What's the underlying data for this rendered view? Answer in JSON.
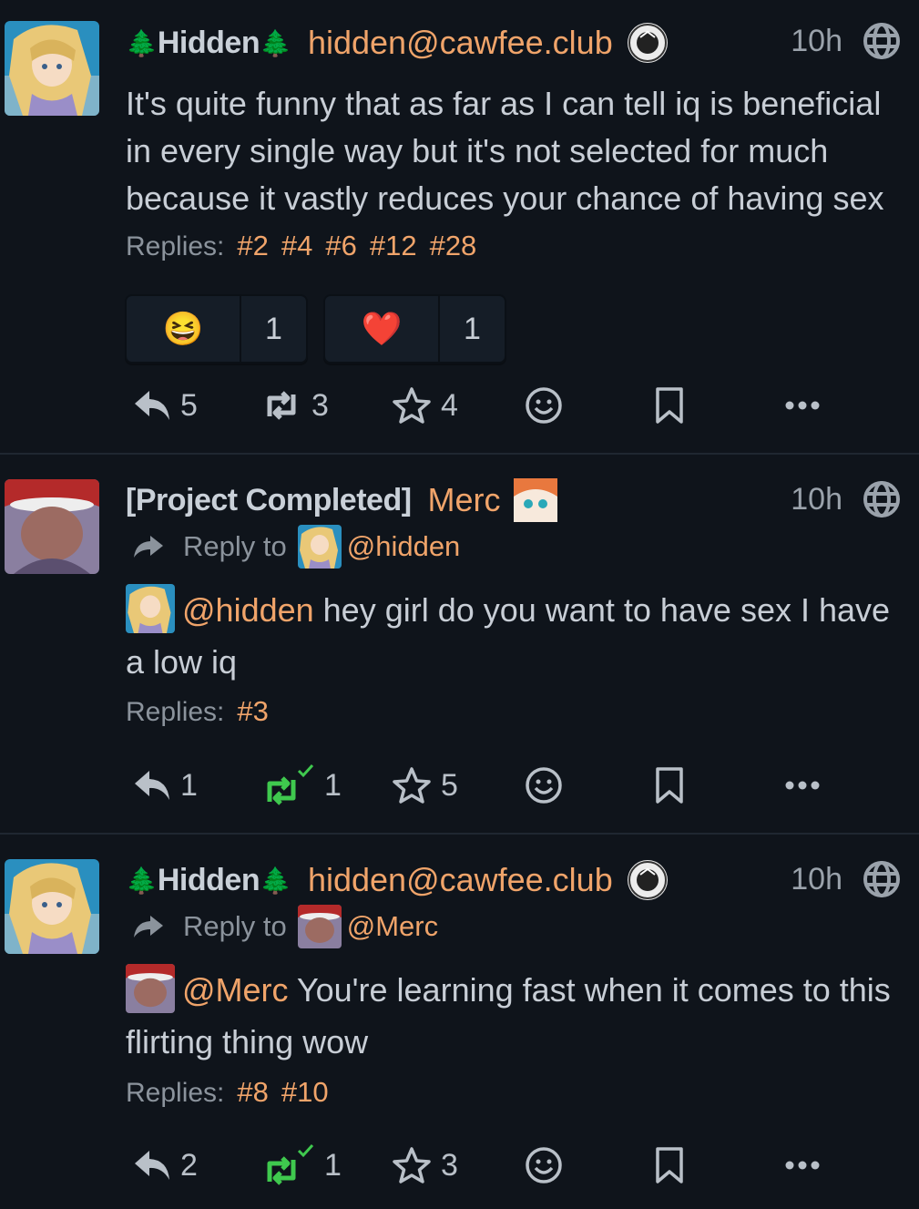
{
  "posts": [
    {
      "display_name": "Hidden",
      "handle": "hidden@cawfee.club",
      "time": "10h",
      "reply_to": null,
      "body": "It's quite funny that as far as I can tell iq is beneficial in every single way but it's not selected for much because it vastly reduces your chance of having sex",
      "replies_label": "Replies:",
      "replies": [
        "#2",
        "#4",
        "#6",
        "#12",
        "#28"
      ],
      "reactions": [
        {
          "emoji": "😆",
          "count": "1"
        },
        {
          "emoji": "❤️",
          "count": "1"
        }
      ],
      "actions": {
        "reply": "5",
        "repeat": "3",
        "favorite": "4"
      }
    },
    {
      "display_name": "[Project Completed]",
      "handle": "Merc",
      "time": "10h",
      "reply_to_label": "Reply to",
      "reply_to": "@hidden",
      "mention": "@hidden",
      "body": " hey girl do you want to have sex I have a low iq",
      "replies_label": "Replies:",
      "replies": [
        "#3"
      ],
      "actions": {
        "reply": "1",
        "repeat": "1",
        "favorite": "5"
      }
    },
    {
      "display_name": "Hidden",
      "handle": "hidden@cawfee.club",
      "time": "10h",
      "reply_to_label": "Reply to",
      "reply_to": "@Merc",
      "mention": "@Merc",
      "body": " You're learning fast when it comes to this flirting thing wow",
      "replies_label": "Replies:",
      "replies": [
        "#8",
        "#10"
      ],
      "actions": {
        "reply": "2",
        "repeat": "1",
        "favorite": "3"
      }
    }
  ],
  "colors": {
    "accent": "#f0a46a",
    "background": "#0f141b",
    "repeat_active": "#3fc94e"
  },
  "icons": [
    "tree-icon",
    "instance-icon",
    "globe-icon",
    "reply-arrow-icon",
    "reply-icon",
    "repeat-icon",
    "star-icon",
    "emoji-react-icon",
    "bookmark-icon",
    "more-icon"
  ]
}
